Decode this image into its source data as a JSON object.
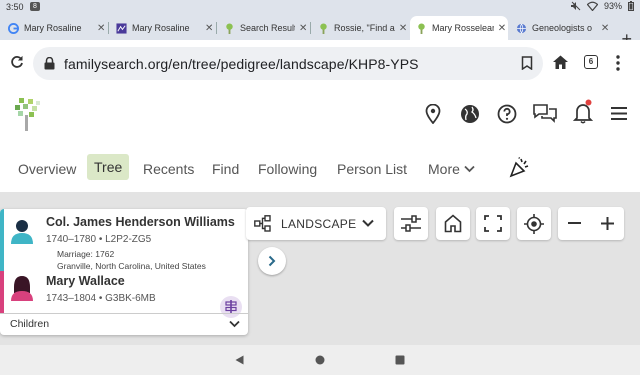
{
  "status_bar": {
    "time": "3:50",
    "notification_badge": "8",
    "battery": "93%"
  },
  "browser": {
    "tabs": [
      {
        "title": "Mary Rosaline",
        "active": false,
        "favicon": "google-g"
      },
      {
        "title": "Mary Rosaline",
        "active": false,
        "favicon": "purple-square"
      },
      {
        "title": "Search Results",
        "active": false,
        "favicon": "familysearch-tree"
      },
      {
        "title": "Rossie, \"Find a",
        "active": false,
        "favicon": "familysearch-tree"
      },
      {
        "title": "Mary Rosselean",
        "active": true,
        "favicon": "familysearch-tree"
      },
      {
        "title": "Geneologists o",
        "active": false,
        "favicon": "globe"
      }
    ],
    "new_tab_label": "+",
    "url": "familysearch.org/en/tree/pedigree/landscape/KHP8-YPS",
    "tab_count": "6"
  },
  "nav": {
    "items": [
      "Overview",
      "Tree",
      "Recents",
      "Find",
      "Following",
      "Person List"
    ],
    "active": "Tree",
    "more_label": "More"
  },
  "tree": {
    "view_mode_label": "LANDSCAPE",
    "husband": {
      "name": "Col. James Henderson Williams",
      "meta": "1740–1780 • L2P2-ZG5"
    },
    "marriage": {
      "line1": "Marriage: 1762",
      "line2": "Granville, North Carolina, United States"
    },
    "wife": {
      "name": "Mary Wallace",
      "meta": "1743–1804 • G3BK-6MB"
    },
    "children_label": "Children"
  },
  "colors": {
    "male": "#3fb5c6",
    "female": "#d8417d",
    "active_tab_bg": "#dbe8c7",
    "tree_bg": "#e3e3e3"
  }
}
